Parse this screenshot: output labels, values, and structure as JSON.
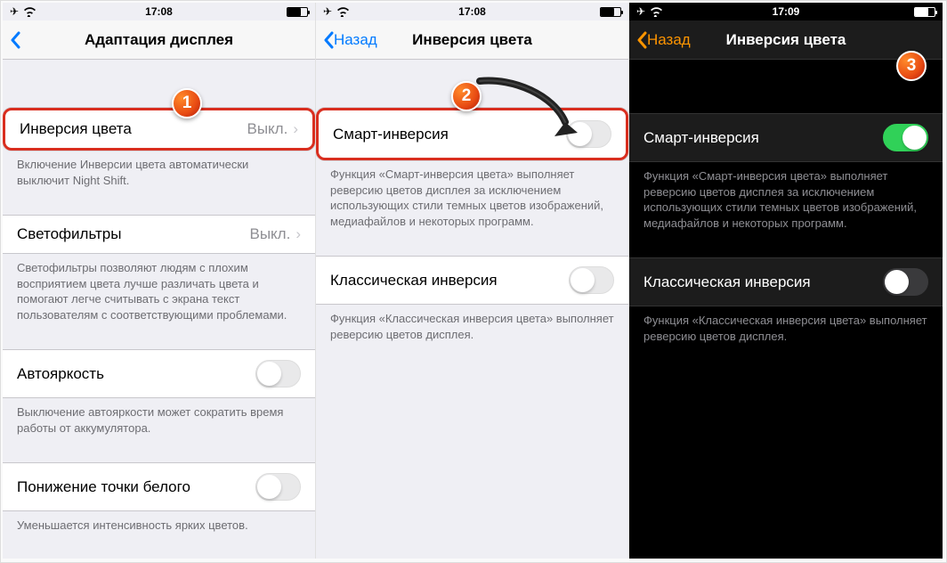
{
  "screens": [
    {
      "time": "17:08",
      "back_label": "",
      "title": "Адаптация дисплея",
      "groups": {
        "color_inversion": {
          "label": "Инверсия цвета",
          "value": "Выкл."
        },
        "color_inversion_footer": "Включение Инверсии цвета автоматически выключит Night Shift.",
        "color_filters": {
          "label": "Светофильтры",
          "value": "Выкл."
        },
        "color_filters_footer": "Светофильтры позволяют людям с плохим восприятием цвета лучше различать цвета и помогают легче считывать с экрана текст пользователям с соответствующими проблемами.",
        "auto_brightness": {
          "label": "Автояркость"
        },
        "auto_brightness_footer": "Выключение автояркости может сократить время работы от аккумулятора.",
        "white_point": {
          "label": "Понижение точки белого"
        },
        "white_point_footer": "Уменьшается интенсивность ярких цветов."
      }
    },
    {
      "time": "17:08",
      "back_label": "Назад",
      "title": "Инверсия цвета",
      "groups": {
        "smart": {
          "label": "Смарт-инверсия"
        },
        "smart_footer": "Функция «Смарт-инверсия цвета» выполняет реверсию цветов дисплея за исключением использующих стили темных цветов изображений, медиафайлов и некоторых программ.",
        "classic": {
          "label": "Классическая инверсия"
        },
        "classic_footer": "Функция «Классическая инверсия цвета» выполняет реверсию цветов дисплея."
      }
    },
    {
      "time": "17:09",
      "back_label": "Назад",
      "title": "Инверсия цвета",
      "groups": {
        "smart": {
          "label": "Смарт-инверсия"
        },
        "smart_footer": "Функция «Смарт-инверсия цвета» выполняет реверсию цветов дисплея за исключением использующих стили темных цветов изображений, медиафайлов и некоторых программ.",
        "classic": {
          "label": "Классическая инверсия"
        },
        "classic_footer": "Функция «Классическая инверсия цвета» выполняет реверсию цветов дисплея."
      }
    }
  ],
  "badges": {
    "b1": "1",
    "b2": "2",
    "b3": "3"
  }
}
